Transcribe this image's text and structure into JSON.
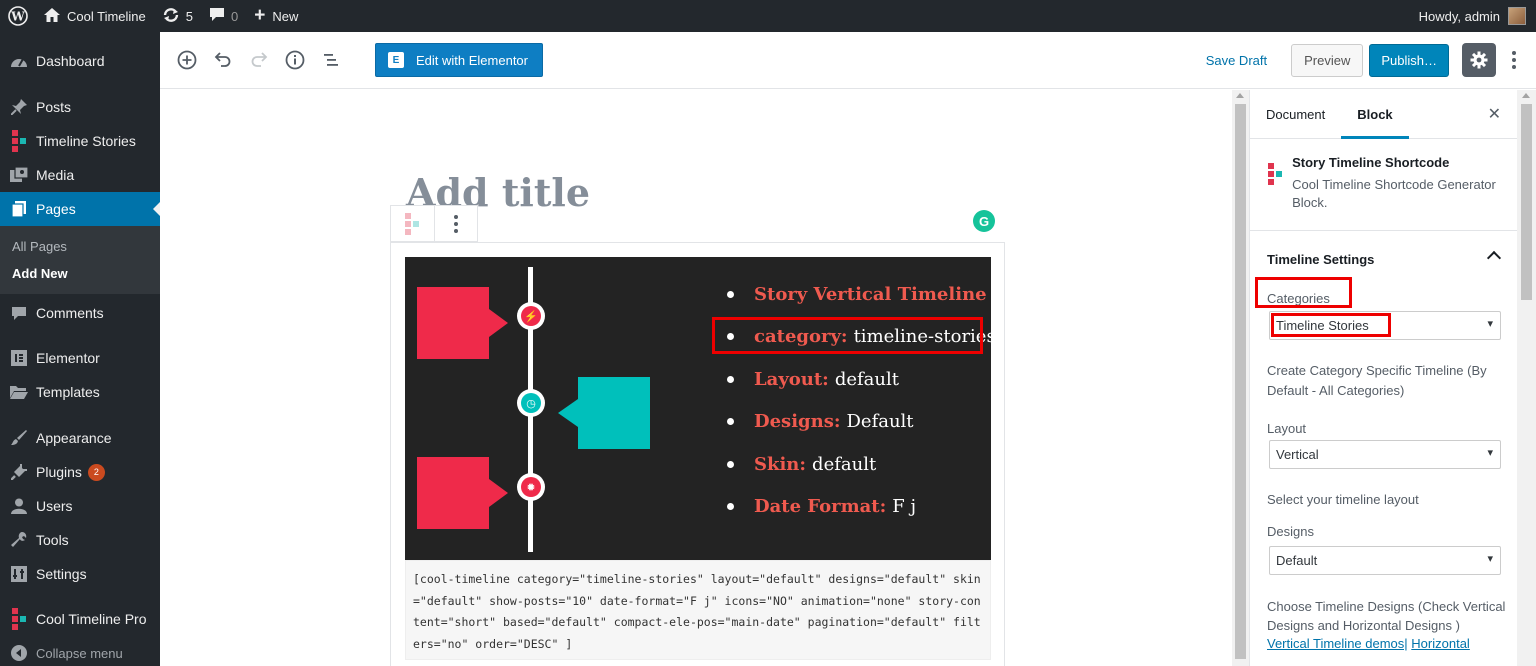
{
  "adminbar": {
    "site_name": "Cool Timeline",
    "updates_count": "5",
    "comments_count": "0",
    "new_label": "New",
    "howdy": "Howdy, admin"
  },
  "sidebar": {
    "items": [
      {
        "label": "Dashboard",
        "icon": "dashboard-icon"
      },
      {
        "label": "Posts",
        "icon": "pin-icon"
      },
      {
        "label": "Timeline Stories",
        "icon": "timeline-icon"
      },
      {
        "label": "Media",
        "icon": "media-icon"
      },
      {
        "label": "Pages",
        "icon": "pages-icon"
      },
      {
        "label": "Comments",
        "icon": "comment-icon"
      },
      {
        "label": "Elementor",
        "icon": "elementor-icon"
      },
      {
        "label": "Templates",
        "icon": "folder-icon"
      },
      {
        "label": "Appearance",
        "icon": "brush-icon"
      },
      {
        "label": "Plugins",
        "icon": "plugin-icon",
        "badge": "2"
      },
      {
        "label": "Users",
        "icon": "user-icon"
      },
      {
        "label": "Tools",
        "icon": "wrench-icon"
      },
      {
        "label": "Settings",
        "icon": "settings-icon"
      },
      {
        "label": "Cool Timeline Pro",
        "icon": "timeline-icon"
      },
      {
        "label": "Collapse menu",
        "icon": "collapse-icon"
      }
    ],
    "submenu": [
      "All Pages",
      "Add New"
    ]
  },
  "header": {
    "edit_elementor": "Edit with Elementor",
    "save_draft": "Save Draft",
    "preview": "Preview",
    "publish": "Publish…"
  },
  "editor": {
    "title_placeholder": "Add title",
    "preview_list": [
      {
        "key": "",
        "title": "Story Vertical Timeline",
        "value": ""
      },
      {
        "key": "category:",
        "title": "",
        "value": "timeline-stories"
      },
      {
        "key": "Layout:",
        "title": "",
        "value": "default"
      },
      {
        "key": "Designs:",
        "title": "",
        "value": "Default"
      },
      {
        "key": "Skin:",
        "title": "",
        "value": "default"
      },
      {
        "key": "Date Format:",
        "title": "",
        "value": "F j"
      }
    ],
    "shortcode": "[cool-timeline category=\"timeline-stories\" layout=\"default\" designs=\"default\" skin=\"default\" show-posts=\"10\" date-format=\"F j\" icons=\"NO\" animation=\"none\" story-content=\"short\" based=\"default\" compact-ele-pos=\"main-date\" pagination=\"default\" filters=\"no\" order=\"DESC\" ]",
    "colors": {
      "red": "#ef2a4a",
      "teal": "#00c0bb",
      "dark": "#232323",
      "accent_text": "#ef5a4f"
    }
  },
  "settings": {
    "tabs": [
      "Document",
      "Block"
    ],
    "block_title": "Story Timeline Shortcode",
    "block_desc": "Cool Timeline Shortcode Generator Block.",
    "panel_title": "Timeline Settings",
    "categories_label": "Categories",
    "categories_value": "Timeline Stories",
    "categories_help": "Create Category Specific Timeline (By Default - All Categories)",
    "layout_label": "Layout",
    "layout_value": "Vertical",
    "layout_help": "Select your timeline layout",
    "designs_label": "Designs",
    "designs_value": "Default",
    "designs_help": "Choose Timeline Designs (Check Vertical Designs and Horizontal Designs )",
    "link_vertical": "Vertical Timeline demos|",
    "link_horizontal": "Horizontal"
  }
}
